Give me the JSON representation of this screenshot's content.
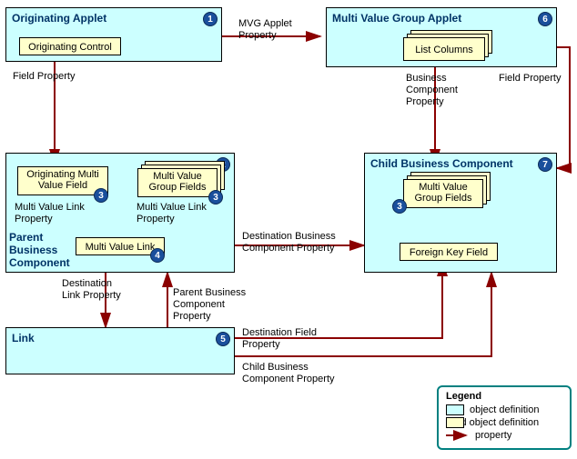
{
  "boxes": {
    "originating_applet": {
      "title": "Originating Applet",
      "num": "1"
    },
    "mvg_applet": {
      "title": "Multi Value Group Applet",
      "num": "6"
    },
    "parent_bc": {
      "title": "Parent\nBusiness\nComponent",
      "num": "2"
    },
    "child_bc": {
      "title": "Child Business Component",
      "num": "7"
    },
    "link": {
      "title": "Link",
      "num": "5"
    }
  },
  "children": {
    "originating_control": {
      "label": "Originating Control"
    },
    "list_columns": {
      "label": "List Columns"
    },
    "omv_field": {
      "label": "Originating Multi\nValue Field",
      "num": "3"
    },
    "mvg_fields_parent": {
      "label": "Multi Value\nGroup Fields",
      "num": "3"
    },
    "mv_link": {
      "label": "Multi Value Link",
      "num": "4"
    },
    "mvg_fields_child": {
      "label": "Multi Value\nGroup Fields",
      "num": "3"
    },
    "foreign_key": {
      "label": "Foreign Key Field"
    }
  },
  "labels": {
    "mvg_applet_property": "MVG Applet\nProperty",
    "field_property_left": "Field Property",
    "field_property_right": "Field Property",
    "bc_property": "Business\nComponent\nProperty",
    "mvl_property_left": "Multi Value Link\nProperty",
    "mvl_property_right": "Multi Value Link\nProperty",
    "dest_bc_property": "Destination Business\nComponent Property",
    "dest_link_property": "Destination\nLink Property",
    "parent_bc_property": "Parent Business\nComponent\nProperty",
    "dest_field_property": "Destination Field\nProperty",
    "child_bc_property": "Child Business\nComponent Property"
  },
  "legend": {
    "title": "Legend",
    "object_definition": "object definition",
    "child_object_definition": "child object definition",
    "property": "property"
  },
  "chart_data": {
    "type": "diagram",
    "nodes": [
      {
        "id": 1,
        "name": "Originating Applet",
        "children": [
          "Originating Control"
        ]
      },
      {
        "id": 6,
        "name": "Multi Value Group Applet",
        "children": [
          "List Columns"
        ]
      },
      {
        "id": 2,
        "name": "Parent Business Component",
        "children": [
          "Originating Multi Value Field (3)",
          "Multi Value Group Fields (3)",
          "Multi Value Link (4)"
        ]
      },
      {
        "id": 7,
        "name": "Child Business Component",
        "children": [
          "Multi Value Group Fields (3)",
          "Foreign Key Field"
        ]
      },
      {
        "id": 5,
        "name": "Link",
        "children": []
      }
    ],
    "edges": [
      {
        "from": "Originating Applet",
        "to": "Multi Value Group Applet",
        "label": "MVG Applet Property"
      },
      {
        "from": "Originating Control",
        "to": "Originating Multi Value Field",
        "label": "Field Property"
      },
      {
        "from": "List Columns",
        "to": "Multi Value Group Fields (child)",
        "label": "Field Property"
      },
      {
        "from": "Multi Value Group Applet",
        "to": "Child Business Component",
        "label": "Business Component Property"
      },
      {
        "from": "Originating Multi Value Field",
        "to": "Multi Value Link",
        "label": "Multi Value Link Property"
      },
      {
        "from": "Multi Value Group Fields (parent)",
        "to": "Multi Value Link",
        "label": "Multi Value Link Property"
      },
      {
        "from": "Multi Value Link",
        "to": "Child Business Component",
        "label": "Destination Business Component Property"
      },
      {
        "from": "Multi Value Link",
        "to": "Link",
        "label": "Destination Link Property"
      },
      {
        "from": "Link",
        "to": "Parent Business Component",
        "label": "Parent Business Component Property"
      },
      {
        "from": "Link",
        "to": "Foreign Key Field",
        "label": "Destination Field Property"
      },
      {
        "from": "Link",
        "to": "Child Business Component",
        "label": "Child Business Component Property"
      }
    ]
  }
}
